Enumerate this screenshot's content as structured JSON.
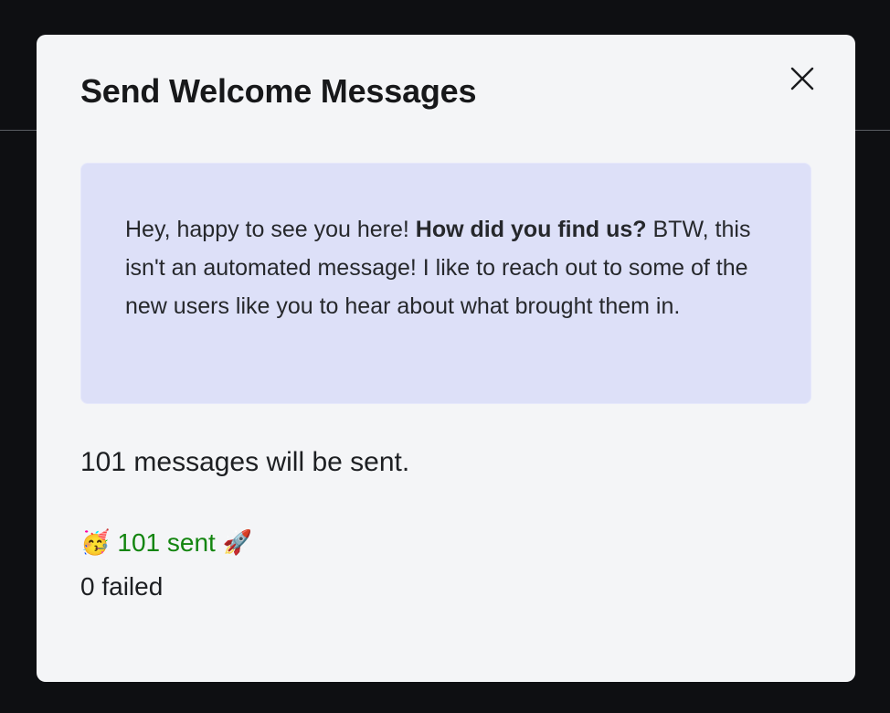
{
  "modal": {
    "title": "Send Welcome Messages",
    "close_icon": "close-icon"
  },
  "message": {
    "text_before": "Hey, happy to see you here! ",
    "text_bold": "How did you find us?",
    "text_after": " BTW, this isn't an automated message! I like to reach out to some of the new users like you to hear about what brought them in."
  },
  "summary": {
    "count_text": "101 messages will be sent.",
    "sent_emoji_before": "🥳",
    "sent_text": "101 sent",
    "sent_emoji_after": "🚀",
    "failed_text": "0 failed"
  },
  "colors": {
    "backdrop": "#0e0f12",
    "modal_bg": "#f4f5f7",
    "message_bg": "#dde0f8",
    "success": "#13850f"
  }
}
